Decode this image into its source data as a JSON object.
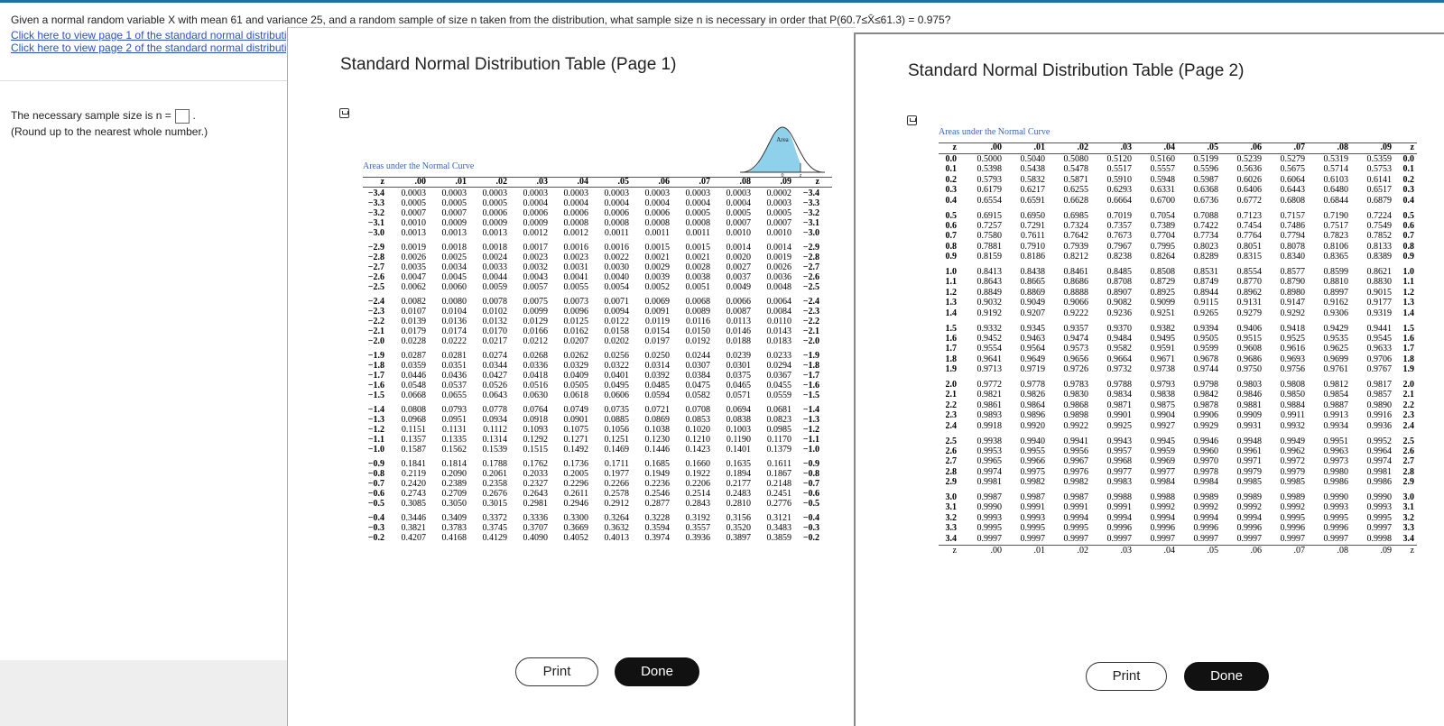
{
  "question": "Given a normal random variable X with mean 61 and variance 25, and a random sample of size n taken from the distribution, what sample size n is necessary in order that P(60.7≤X̄≤61.3) = 0.975?",
  "links": [
    "Click here to view page 1 of the standard normal distribution table.",
    "Click here to view page 2 of the standard normal distribution table."
  ],
  "answer_prompt": "The necessary sample size is n =",
  "answer_suffix": ".",
  "hint": "(Round up to the nearest whole number.)",
  "window1": {
    "title": "Standard Normal Distribution Table (Page 1)",
    "areas_label": "Areas under the Normal Curve",
    "curve_label": "Area",
    "curve_zero": "0",
    "curve_z": "z",
    "headers": [
      "z",
      ".00",
      ".01",
      ".02",
      ".03",
      ".04",
      ".05",
      ".06",
      ".07",
      ".08",
      ".09",
      "z"
    ],
    "rows": [
      [
        "−3.4",
        "0.0003",
        "0.0003",
        "0.0003",
        "0.0003",
        "0.0003",
        "0.0003",
        "0.0003",
        "0.0003",
        "0.0003",
        "0.0002",
        "−3.4"
      ],
      [
        "−3.3",
        "0.0005",
        "0.0005",
        "0.0005",
        "0.0004",
        "0.0004",
        "0.0004",
        "0.0004",
        "0.0004",
        "0.0004",
        "0.0003",
        "−3.3"
      ],
      [
        "−3.2",
        "0.0007",
        "0.0007",
        "0.0006",
        "0.0006",
        "0.0006",
        "0.0006",
        "0.0006",
        "0.0005",
        "0.0005",
        "0.0005",
        "−3.2"
      ],
      [
        "−3.1",
        "0.0010",
        "0.0009",
        "0.0009",
        "0.0009",
        "0.0008",
        "0.0008",
        "0.0008",
        "0.0008",
        "0.0007",
        "0.0007",
        "−3.1"
      ],
      [
        "−3.0",
        "0.0013",
        "0.0013",
        "0.0013",
        "0.0012",
        "0.0012",
        "0.0011",
        "0.0011",
        "0.0011",
        "0.0010",
        "0.0010",
        "−3.0"
      ],
      [
        "−2.9",
        "0.0019",
        "0.0018",
        "0.0018",
        "0.0017",
        "0.0016",
        "0.0016",
        "0.0015",
        "0.0015",
        "0.0014",
        "0.0014",
        "−2.9"
      ],
      [
        "−2.8",
        "0.0026",
        "0.0025",
        "0.0024",
        "0.0023",
        "0.0023",
        "0.0022",
        "0.0021",
        "0.0021",
        "0.0020",
        "0.0019",
        "−2.8"
      ],
      [
        "−2.7",
        "0.0035",
        "0.0034",
        "0.0033",
        "0.0032",
        "0.0031",
        "0.0030",
        "0.0029",
        "0.0028",
        "0.0027",
        "0.0026",
        "−2.7"
      ],
      [
        "−2.6",
        "0.0047",
        "0.0045",
        "0.0044",
        "0.0043",
        "0.0041",
        "0.0040",
        "0.0039",
        "0.0038",
        "0.0037",
        "0.0036",
        "−2.6"
      ],
      [
        "−2.5",
        "0.0062",
        "0.0060",
        "0.0059",
        "0.0057",
        "0.0055",
        "0.0054",
        "0.0052",
        "0.0051",
        "0.0049",
        "0.0048",
        "−2.5"
      ],
      [
        "−2.4",
        "0.0082",
        "0.0080",
        "0.0078",
        "0.0075",
        "0.0073",
        "0.0071",
        "0.0069",
        "0.0068",
        "0.0066",
        "0.0064",
        "−2.4"
      ],
      [
        "−2.3",
        "0.0107",
        "0.0104",
        "0.0102",
        "0.0099",
        "0.0096",
        "0.0094",
        "0.0091",
        "0.0089",
        "0.0087",
        "0.0084",
        "−2.3"
      ],
      [
        "−2.2",
        "0.0139",
        "0.0136",
        "0.0132",
        "0.0129",
        "0.0125",
        "0.0122",
        "0.0119",
        "0.0116",
        "0.0113",
        "0.0110",
        "−2.2"
      ],
      [
        "−2.1",
        "0.0179",
        "0.0174",
        "0.0170",
        "0.0166",
        "0.0162",
        "0.0158",
        "0.0154",
        "0.0150",
        "0.0146",
        "0.0143",
        "−2.1"
      ],
      [
        "−2.0",
        "0.0228",
        "0.0222",
        "0.0217",
        "0.0212",
        "0.0207",
        "0.0202",
        "0.0197",
        "0.0192",
        "0.0188",
        "0.0183",
        "−2.0"
      ],
      [
        "−1.9",
        "0.0287",
        "0.0281",
        "0.0274",
        "0.0268",
        "0.0262",
        "0.0256",
        "0.0250",
        "0.0244",
        "0.0239",
        "0.0233",
        "−1.9"
      ],
      [
        "−1.8",
        "0.0359",
        "0.0351",
        "0.0344",
        "0.0336",
        "0.0329",
        "0.0322",
        "0.0314",
        "0.0307",
        "0.0301",
        "0.0294",
        "−1.8"
      ],
      [
        "−1.7",
        "0.0446",
        "0.0436",
        "0.0427",
        "0.0418",
        "0.0409",
        "0.0401",
        "0.0392",
        "0.0384",
        "0.0375",
        "0.0367",
        "−1.7"
      ],
      [
        "−1.6",
        "0.0548",
        "0.0537",
        "0.0526",
        "0.0516",
        "0.0505",
        "0.0495",
        "0.0485",
        "0.0475",
        "0.0465",
        "0.0455",
        "−1.6"
      ],
      [
        "−1.5",
        "0.0668",
        "0.0655",
        "0.0643",
        "0.0630",
        "0.0618",
        "0.0606",
        "0.0594",
        "0.0582",
        "0.0571",
        "0.0559",
        "−1.5"
      ],
      [
        "−1.4",
        "0.0808",
        "0.0793",
        "0.0778",
        "0.0764",
        "0.0749",
        "0.0735",
        "0.0721",
        "0.0708",
        "0.0694",
        "0.0681",
        "−1.4"
      ],
      [
        "−1.3",
        "0.0968",
        "0.0951",
        "0.0934",
        "0.0918",
        "0.0901",
        "0.0885",
        "0.0869",
        "0.0853",
        "0.0838",
        "0.0823",
        "−1.3"
      ],
      [
        "−1.2",
        "0.1151",
        "0.1131",
        "0.1112",
        "0.1093",
        "0.1075",
        "0.1056",
        "0.1038",
        "0.1020",
        "0.1003",
        "0.0985",
        "−1.2"
      ],
      [
        "−1.1",
        "0.1357",
        "0.1335",
        "0.1314",
        "0.1292",
        "0.1271",
        "0.1251",
        "0.1230",
        "0.1210",
        "0.1190",
        "0.1170",
        "−1.1"
      ],
      [
        "−1.0",
        "0.1587",
        "0.1562",
        "0.1539",
        "0.1515",
        "0.1492",
        "0.1469",
        "0.1446",
        "0.1423",
        "0.1401",
        "0.1379",
        "−1.0"
      ],
      [
        "−0.9",
        "0.1841",
        "0.1814",
        "0.1788",
        "0.1762",
        "0.1736",
        "0.1711",
        "0.1685",
        "0.1660",
        "0.1635",
        "0.1611",
        "−0.9"
      ],
      [
        "−0.8",
        "0.2119",
        "0.2090",
        "0.2061",
        "0.2033",
        "0.2005",
        "0.1977",
        "0.1949",
        "0.1922",
        "0.1894",
        "0.1867",
        "−0.8"
      ],
      [
        "−0.7",
        "0.2420",
        "0.2389",
        "0.2358",
        "0.2327",
        "0.2296",
        "0.2266",
        "0.2236",
        "0.2206",
        "0.2177",
        "0.2148",
        "−0.7"
      ],
      [
        "−0.6",
        "0.2743",
        "0.2709",
        "0.2676",
        "0.2643",
        "0.2611",
        "0.2578",
        "0.2546",
        "0.2514",
        "0.2483",
        "0.2451",
        "−0.6"
      ],
      [
        "−0.5",
        "0.3085",
        "0.3050",
        "0.3015",
        "0.2981",
        "0.2946",
        "0.2912",
        "0.2877",
        "0.2843",
        "0.2810",
        "0.2776",
        "−0.5"
      ],
      [
        "−0.4",
        "0.3446",
        "0.3409",
        "0.3372",
        "0.3336",
        "0.3300",
        "0.3264",
        "0.3228",
        "0.3192",
        "0.3156",
        "0.3121",
        "−0.4"
      ],
      [
        "−0.3",
        "0.3821",
        "0.3783",
        "0.3745",
        "0.3707",
        "0.3669",
        "0.3632",
        "0.3594",
        "0.3557",
        "0.3520",
        "0.3483",
        "−0.3"
      ],
      [
        "−0.2",
        "0.4207",
        "0.4168",
        "0.4129",
        "0.4090",
        "0.4052",
        "0.4013",
        "0.3974",
        "0.3936",
        "0.3897",
        "0.3859",
        "−0.2"
      ]
    ],
    "print_label": "Print",
    "done_label": "Done"
  },
  "window2": {
    "title": "Standard Normal Distribution Table (Page 2)",
    "areas_label": "Areas under the Normal Curve",
    "headers": [
      "z",
      ".00",
      ".01",
      ".02",
      ".03",
      ".04",
      ".05",
      ".06",
      ".07",
      ".08",
      ".09",
      "z"
    ],
    "rows": [
      [
        "0.0",
        "0.5000",
        "0.5040",
        "0.5080",
        "0.5120",
        "0.5160",
        "0.5199",
        "0.5239",
        "0.5279",
        "0.5319",
        "0.5359",
        "0.0"
      ],
      [
        "0.1",
        "0.5398",
        "0.5438",
        "0.5478",
        "0.5517",
        "0.5557",
        "0.5596",
        "0.5636",
        "0.5675",
        "0.5714",
        "0.5753",
        "0.1"
      ],
      [
        "0.2",
        "0.5793",
        "0.5832",
        "0.5871",
        "0.5910",
        "0.5948",
        "0.5987",
        "0.6026",
        "0.6064",
        "0.6103",
        "0.6141",
        "0.2"
      ],
      [
        "0.3",
        "0.6179",
        "0.6217",
        "0.6255",
        "0.6293",
        "0.6331",
        "0.6368",
        "0.6406",
        "0.6443",
        "0.6480",
        "0.6517",
        "0.3"
      ],
      [
        "0.4",
        "0.6554",
        "0.6591",
        "0.6628",
        "0.6664",
        "0.6700",
        "0.6736",
        "0.6772",
        "0.6808",
        "0.6844",
        "0.6879",
        "0.4"
      ],
      [
        "0.5",
        "0.6915",
        "0.6950",
        "0.6985",
        "0.7019",
        "0.7054",
        "0.7088",
        "0.7123",
        "0.7157",
        "0.7190",
        "0.7224",
        "0.5"
      ],
      [
        "0.6",
        "0.7257",
        "0.7291",
        "0.7324",
        "0.7357",
        "0.7389",
        "0.7422",
        "0.7454",
        "0.7486",
        "0.7517",
        "0.7549",
        "0.6"
      ],
      [
        "0.7",
        "0.7580",
        "0.7611",
        "0.7642",
        "0.7673",
        "0.7704",
        "0.7734",
        "0.7764",
        "0.7794",
        "0.7823",
        "0.7852",
        "0.7"
      ],
      [
        "0.8",
        "0.7881",
        "0.7910",
        "0.7939",
        "0.7967",
        "0.7995",
        "0.8023",
        "0.8051",
        "0.8078",
        "0.8106",
        "0.8133",
        "0.8"
      ],
      [
        "0.9",
        "0.8159",
        "0.8186",
        "0.8212",
        "0.8238",
        "0.8264",
        "0.8289",
        "0.8315",
        "0.8340",
        "0.8365",
        "0.8389",
        "0.9"
      ],
      [
        "1.0",
        "0.8413",
        "0.8438",
        "0.8461",
        "0.8485",
        "0.8508",
        "0.8531",
        "0.8554",
        "0.8577",
        "0.8599",
        "0.8621",
        "1.0"
      ],
      [
        "1.1",
        "0.8643",
        "0.8665",
        "0.8686",
        "0.8708",
        "0.8729",
        "0.8749",
        "0.8770",
        "0.8790",
        "0.8810",
        "0.8830",
        "1.1"
      ],
      [
        "1.2",
        "0.8849",
        "0.8869",
        "0.8888",
        "0.8907",
        "0.8925",
        "0.8944",
        "0.8962",
        "0.8980",
        "0.8997",
        "0.9015",
        "1.2"
      ],
      [
        "1.3",
        "0.9032",
        "0.9049",
        "0.9066",
        "0.9082",
        "0.9099",
        "0.9115",
        "0.9131",
        "0.9147",
        "0.9162",
        "0.9177",
        "1.3"
      ],
      [
        "1.4",
        "0.9192",
        "0.9207",
        "0.9222",
        "0.9236",
        "0.9251",
        "0.9265",
        "0.9279",
        "0.9292",
        "0.9306",
        "0.9319",
        "1.4"
      ],
      [
        "1.5",
        "0.9332",
        "0.9345",
        "0.9357",
        "0.9370",
        "0.9382",
        "0.9394",
        "0.9406",
        "0.9418",
        "0.9429",
        "0.9441",
        "1.5"
      ],
      [
        "1.6",
        "0.9452",
        "0.9463",
        "0.9474",
        "0.9484",
        "0.9495",
        "0.9505",
        "0.9515",
        "0.9525",
        "0.9535",
        "0.9545",
        "1.6"
      ],
      [
        "1.7",
        "0.9554",
        "0.9564",
        "0.9573",
        "0.9582",
        "0.9591",
        "0.9599",
        "0.9608",
        "0.9616",
        "0.9625",
        "0.9633",
        "1.7"
      ],
      [
        "1.8",
        "0.9641",
        "0.9649",
        "0.9656",
        "0.9664",
        "0.9671",
        "0.9678",
        "0.9686",
        "0.9693",
        "0.9699",
        "0.9706",
        "1.8"
      ],
      [
        "1.9",
        "0.9713",
        "0.9719",
        "0.9726",
        "0.9732",
        "0.9738",
        "0.9744",
        "0.9750",
        "0.9756",
        "0.9761",
        "0.9767",
        "1.9"
      ],
      [
        "2.0",
        "0.9772",
        "0.9778",
        "0.9783",
        "0.9788",
        "0.9793",
        "0.9798",
        "0.9803",
        "0.9808",
        "0.9812",
        "0.9817",
        "2.0"
      ],
      [
        "2.1",
        "0.9821",
        "0.9826",
        "0.9830",
        "0.9834",
        "0.9838",
        "0.9842",
        "0.9846",
        "0.9850",
        "0.9854",
        "0.9857",
        "2.1"
      ],
      [
        "2.2",
        "0.9861",
        "0.9864",
        "0.9868",
        "0.9871",
        "0.9875",
        "0.9878",
        "0.9881",
        "0.9884",
        "0.9887",
        "0.9890",
        "2.2"
      ],
      [
        "2.3",
        "0.9893",
        "0.9896",
        "0.9898",
        "0.9901",
        "0.9904",
        "0.9906",
        "0.9909",
        "0.9911",
        "0.9913",
        "0.9916",
        "2.3"
      ],
      [
        "2.4",
        "0.9918",
        "0.9920",
        "0.9922",
        "0.9925",
        "0.9927",
        "0.9929",
        "0.9931",
        "0.9932",
        "0.9934",
        "0.9936",
        "2.4"
      ],
      [
        "2.5",
        "0.9938",
        "0.9940",
        "0.9941",
        "0.9943",
        "0.9945",
        "0.9946",
        "0.9948",
        "0.9949",
        "0.9951",
        "0.9952",
        "2.5"
      ],
      [
        "2.6",
        "0.9953",
        "0.9955",
        "0.9956",
        "0.9957",
        "0.9959",
        "0.9960",
        "0.9961",
        "0.9962",
        "0.9963",
        "0.9964",
        "2.6"
      ],
      [
        "2.7",
        "0.9965",
        "0.9966",
        "0.9967",
        "0.9968",
        "0.9969",
        "0.9970",
        "0.9971",
        "0.9972",
        "0.9973",
        "0.9974",
        "2.7"
      ],
      [
        "2.8",
        "0.9974",
        "0.9975",
        "0.9976",
        "0.9977",
        "0.9977",
        "0.9978",
        "0.9979",
        "0.9979",
        "0.9980",
        "0.9981",
        "2.8"
      ],
      [
        "2.9",
        "0.9981",
        "0.9982",
        "0.9982",
        "0.9983",
        "0.9984",
        "0.9984",
        "0.9985",
        "0.9985",
        "0.9986",
        "0.9986",
        "2.9"
      ],
      [
        "3.0",
        "0.9987",
        "0.9987",
        "0.9987",
        "0.9988",
        "0.9988",
        "0.9989",
        "0.9989",
        "0.9989",
        "0.9990",
        "0.9990",
        "3.0"
      ],
      [
        "3.1",
        "0.9990",
        "0.9991",
        "0.9991",
        "0.9991",
        "0.9992",
        "0.9992",
        "0.9992",
        "0.9992",
        "0.9993",
        "0.9993",
        "3.1"
      ],
      [
        "3.2",
        "0.9993",
        "0.9993",
        "0.9994",
        "0.9994",
        "0.9994",
        "0.9994",
        "0.9994",
        "0.9995",
        "0.9995",
        "0.9995",
        "3.2"
      ],
      [
        "3.3",
        "0.9995",
        "0.9995",
        "0.9995",
        "0.9996",
        "0.9996",
        "0.9996",
        "0.9996",
        "0.9996",
        "0.9996",
        "0.9997",
        "3.3"
      ],
      [
        "3.4",
        "0.9997",
        "0.9997",
        "0.9997",
        "0.9997",
        "0.9997",
        "0.9997",
        "0.9997",
        "0.9997",
        "0.9997",
        "0.9998",
        "3.4"
      ]
    ],
    "print_label": "Print",
    "done_label": "Done"
  },
  "colors": {
    "link": "#2a50c8",
    "curve_fill": "#8fd0ea",
    "areas_label": "#3a68b8",
    "done_bg": "#111111"
  },
  "icons": {
    "table_tool": "pin-icon"
  }
}
